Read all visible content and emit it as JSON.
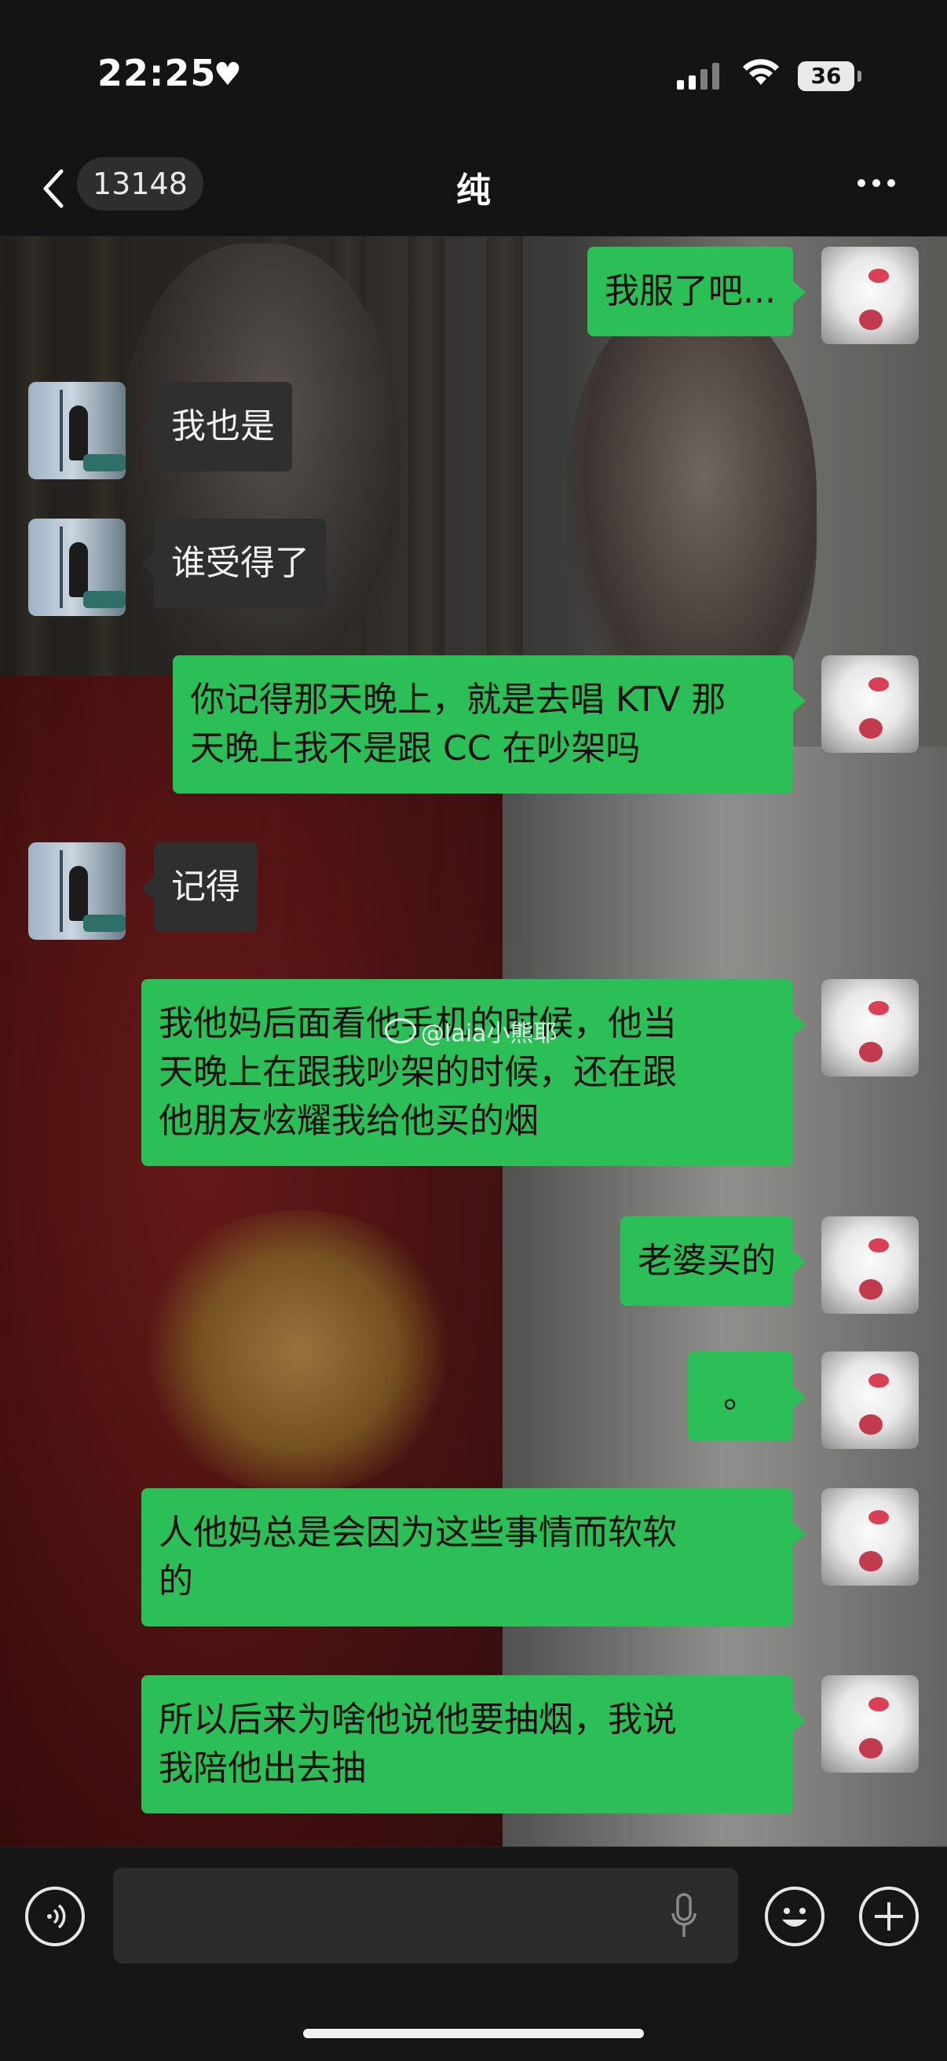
{
  "status_bar": {
    "time": "22:25",
    "battery": "36"
  },
  "header": {
    "back_badge": "13148",
    "title": "纯"
  },
  "messages": [
    {
      "from": "me",
      "text": "我服了吧..."
    },
    {
      "from": "other",
      "text": "我也是"
    },
    {
      "from": "other",
      "text": "谁受得了"
    },
    {
      "from": "me",
      "text": "你记得那天晚上，就是去唱 KTV 那\n天晚上我不是跟 CC 在吵架吗"
    },
    {
      "from": "other",
      "text": "记得"
    },
    {
      "from": "me",
      "text": "我他妈后面看他手机的时候，他当\n天晚上在跟我吵架的时候，还在跟\n他朋友炫耀我给他买的烟"
    },
    {
      "from": "me",
      "text": "老婆买的"
    },
    {
      "from": "me",
      "text": "。"
    },
    {
      "from": "me",
      "text": "人他妈总是会因为这些事情而软软\n的"
    },
    {
      "from": "me",
      "text": "所以后来为啥他说他要抽烟，我说\n我陪他出去抽"
    }
  ],
  "watermark": "@laia小熊耶",
  "icons": {
    "heart": "heart-icon",
    "back": "chevron-left-icon",
    "more": "more-dots-icon",
    "voice": "voice-icon",
    "mic": "mic-icon",
    "emoji": "emoji-icon",
    "plus": "plus-icon"
  },
  "colors": {
    "my_bubble": "#2cbf58",
    "other_bubble": "#2f2f2f",
    "background": "#141414"
  }
}
